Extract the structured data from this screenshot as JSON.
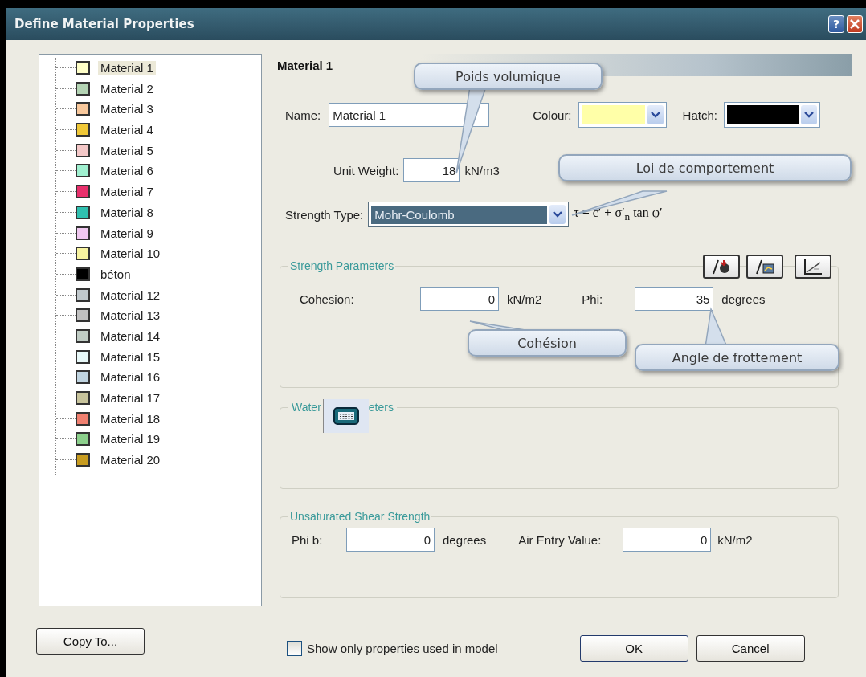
{
  "window": {
    "title": "Define Material Properties",
    "help_button": "?"
  },
  "materials": [
    {
      "label": "Material 1",
      "color": "#ffffc8",
      "selected": true
    },
    {
      "label": "Material 2",
      "color": "#b4d4b4",
      "selected": false
    },
    {
      "label": "Material 3",
      "color": "#f8c89c",
      "selected": false
    },
    {
      "label": "Material 4",
      "color": "#f0c838",
      "selected": false
    },
    {
      "label": "Material 5",
      "color": "#f4c8c8",
      "selected": false
    },
    {
      "label": "Material 6",
      "color": "#a0f0d0",
      "selected": false
    },
    {
      "label": "Material 7",
      "color": "#e8306c",
      "selected": false
    },
    {
      "label": "Material 8",
      "color": "#30c0b0",
      "selected": false
    },
    {
      "label": "Material 9",
      "color": "#f0c8f0",
      "selected": false
    },
    {
      "label": "Material 10",
      "color": "#f8f4a0",
      "selected": false
    },
    {
      "label": "béton",
      "color": "#000000",
      "selected": false
    },
    {
      "label": "Material 12",
      "color": "#c0c8cc",
      "selected": false
    },
    {
      "label": "Material 13",
      "color": "#c0c0c0",
      "selected": false
    },
    {
      "label": "Material 14",
      "color": "#c0ccc4",
      "selected": false
    },
    {
      "label": "Material 15",
      "color": "#e8f8f8",
      "selected": false
    },
    {
      "label": "Material 16",
      "color": "#c0d4e0",
      "selected": false
    },
    {
      "label": "Material 17",
      "color": "#c8c49c",
      "selected": false
    },
    {
      "label": "Material 18",
      "color": "#f08070",
      "selected": false
    },
    {
      "label": "Material 19",
      "color": "#8cd08c",
      "selected": false
    },
    {
      "label": "Material 20",
      "color": "#c89c20",
      "selected": false
    }
  ],
  "header": "Material 1",
  "name_field": {
    "label": "Name:",
    "value": "Material 1"
  },
  "colour_field": {
    "label": "Colour:",
    "color": "#ffffa8"
  },
  "hatch_field": {
    "label": "Hatch:",
    "color": "#000000"
  },
  "unit_weight": {
    "label": "Unit Weight:",
    "value": "18",
    "unit": "kN/m3"
  },
  "strength_type": {
    "label": "Strength Type:",
    "value": "Mohr-Coulomb",
    "focused": true,
    "formula": "τ = c′ + σ′$_{n}$ tan φ′"
  },
  "strength_parameters": {
    "title": "Strength Parameters",
    "fields": [
      {
        "label": "Cohesion:",
        "value": "0",
        "unit": "kN/m2"
      },
      {
        "label": "Phi:",
        "value": "35",
        "unit": "degrees"
      }
    ]
  },
  "water_parameters": {
    "title_parts": [
      "Water",
      "eters"
    ]
  },
  "unsaturated_shear_strength": {
    "title": "Unsaturated Shear Strength",
    "fields": [
      {
        "label": "Phi b:",
        "value": "0",
        "unit": "degrees"
      },
      {
        "label": "Air Entry Value:",
        "value": "0",
        "unit": "kN/m2"
      }
    ]
  },
  "callouts": [
    {
      "text": "Poids volumique"
    },
    {
      "text": "Loi de comportement"
    },
    {
      "text": "Cohésion"
    },
    {
      "text": "Angle de frottement"
    }
  ],
  "show_only_used": {
    "label": "Show only properties used in model",
    "checked": false
  },
  "buttons": {
    "copy": "Copy To...",
    "ok": "OK",
    "cancel": "Cancel"
  }
}
